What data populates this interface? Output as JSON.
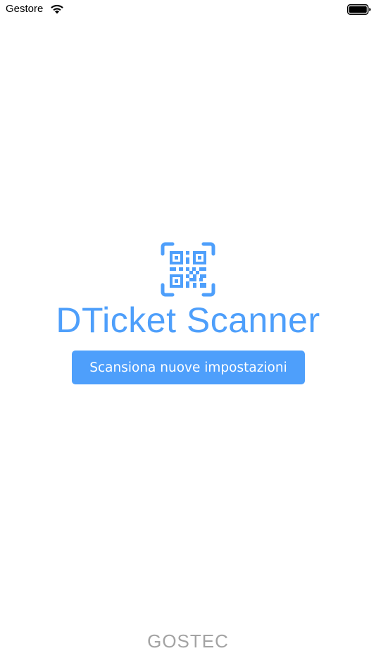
{
  "status_bar": {
    "carrier": "Gestore",
    "wifi_icon": "wifi-icon",
    "battery_icon": "battery-icon"
  },
  "logo": {
    "icon": "qr-code-icon",
    "color": "#4e9ffb"
  },
  "app_title": "DTicket Scanner",
  "scan_button": {
    "label": "Scansiona nuove impostazioni",
    "color": "#4e9ffb"
  },
  "footer": {
    "brand": "GOSTEC"
  }
}
